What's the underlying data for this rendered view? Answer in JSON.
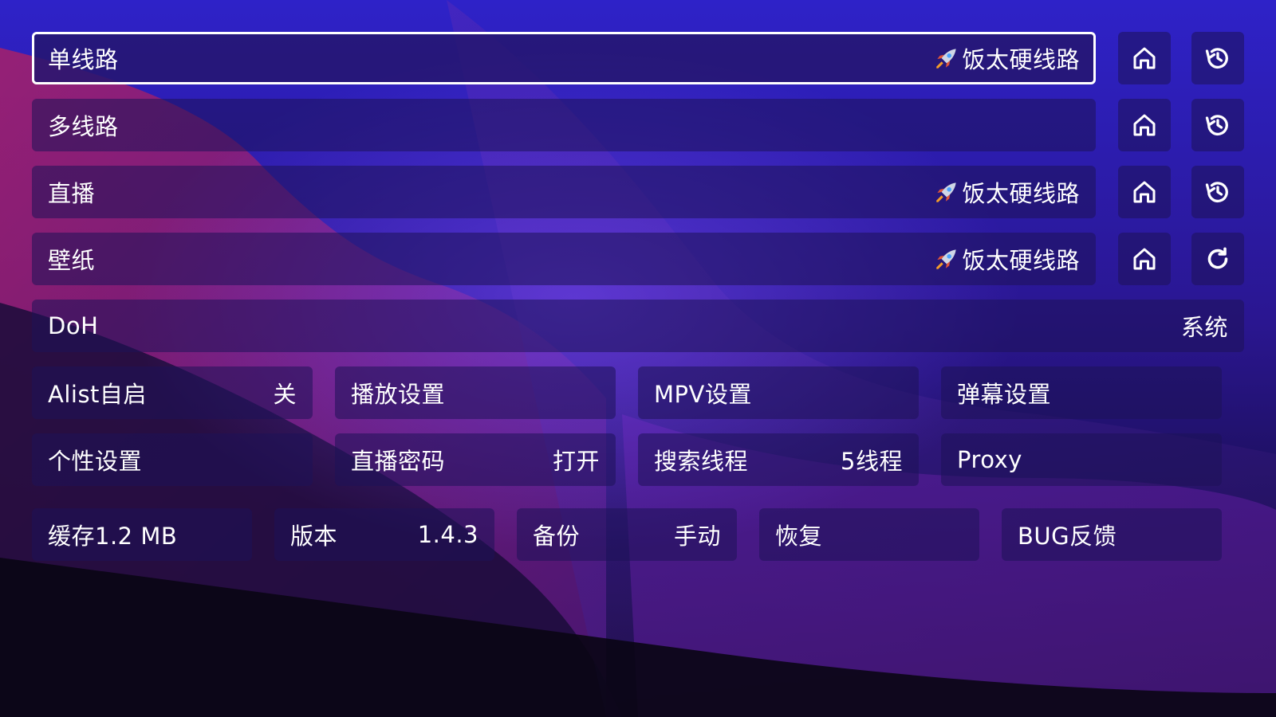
{
  "routes": [
    {
      "label": "单线路",
      "value": "饭太硬线路",
      "has_rocket": true,
      "focused": true,
      "action_icon": "history-icon"
    },
    {
      "label": "多线路",
      "value": "",
      "has_rocket": false,
      "focused": false,
      "action_icon": "history-icon"
    },
    {
      "label": "直播",
      "value": "饭太硬线路",
      "has_rocket": true,
      "focused": false,
      "action_icon": "history-icon"
    },
    {
      "label": "壁纸",
      "value": "饭太硬线路",
      "has_rocket": true,
      "focused": false,
      "action_icon": "refresh-icon"
    }
  ],
  "doh": {
    "label": "DoH",
    "value": "系统"
  },
  "grid_row1": [
    {
      "label": "Alist自启",
      "value": "关"
    },
    {
      "label": "播放设置",
      "value": ""
    },
    {
      "label": "MPV设置",
      "value": ""
    },
    {
      "label": "弹幕设置",
      "value": ""
    }
  ],
  "grid_row2": [
    {
      "label": "个性设置",
      "value": ""
    },
    {
      "label": "直播密码",
      "value": "打开"
    },
    {
      "label": "搜索线程",
      "value": "5线程"
    },
    {
      "label": "Proxy",
      "value": ""
    }
  ],
  "bottom_row": [
    {
      "label": "缓存1.2 MB",
      "value": ""
    },
    {
      "label": "版本",
      "value": "1.4.3"
    },
    {
      "label": "备份",
      "value": "手动"
    },
    {
      "label": "恢复",
      "value": ""
    },
    {
      "label": "BUG反馈",
      "value": ""
    }
  ],
  "icons": {
    "home": "home-icon",
    "history": "history-icon",
    "refresh": "refresh-icon",
    "rocket": "rocket-icon"
  },
  "colors": {
    "accent_border": "#ffffff",
    "tile_bg": "#1e1258",
    "text": "#ffffff"
  }
}
